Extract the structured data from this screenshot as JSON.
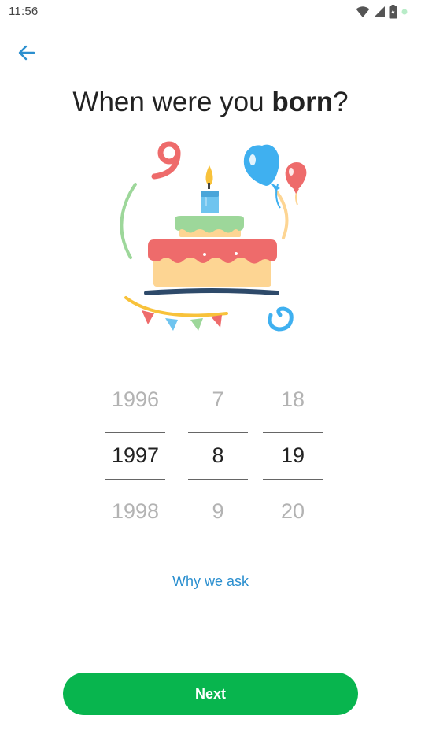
{
  "status_bar": {
    "time": "11:56",
    "icons": [
      "wifi-icon",
      "cell-signal-icon",
      "battery-icon",
      "notification-dot-icon"
    ]
  },
  "header": {
    "back_icon": "arrow-left-icon",
    "title_prefix": "When were you ",
    "title_bold": "born",
    "title_suffix": "?"
  },
  "illustration": {
    "subject": "birthday-cake",
    "colors": {
      "nine": "#ee6b6b",
      "balloon_blue": "#3fb0f0",
      "balloon_red": "#ee6b6b",
      "cake_top": "#9dd79a",
      "cake_base": "#fdd593",
      "icing": "#ee6b6b",
      "plate": "#2e4a6a",
      "candle": "#6fc4ef",
      "flame": "#f8c23b"
    }
  },
  "date_picker": {
    "year": {
      "prev": "1996",
      "selected": "1997",
      "next": "1998"
    },
    "month": {
      "prev": "7",
      "selected": "8",
      "next": "9"
    },
    "day": {
      "prev": "18",
      "selected": "19",
      "next": "20"
    }
  },
  "why_link": "Why we ask",
  "next_button": "Next",
  "colors": {
    "accent": "#2b8fcf",
    "primary_button": "#08b54e"
  }
}
